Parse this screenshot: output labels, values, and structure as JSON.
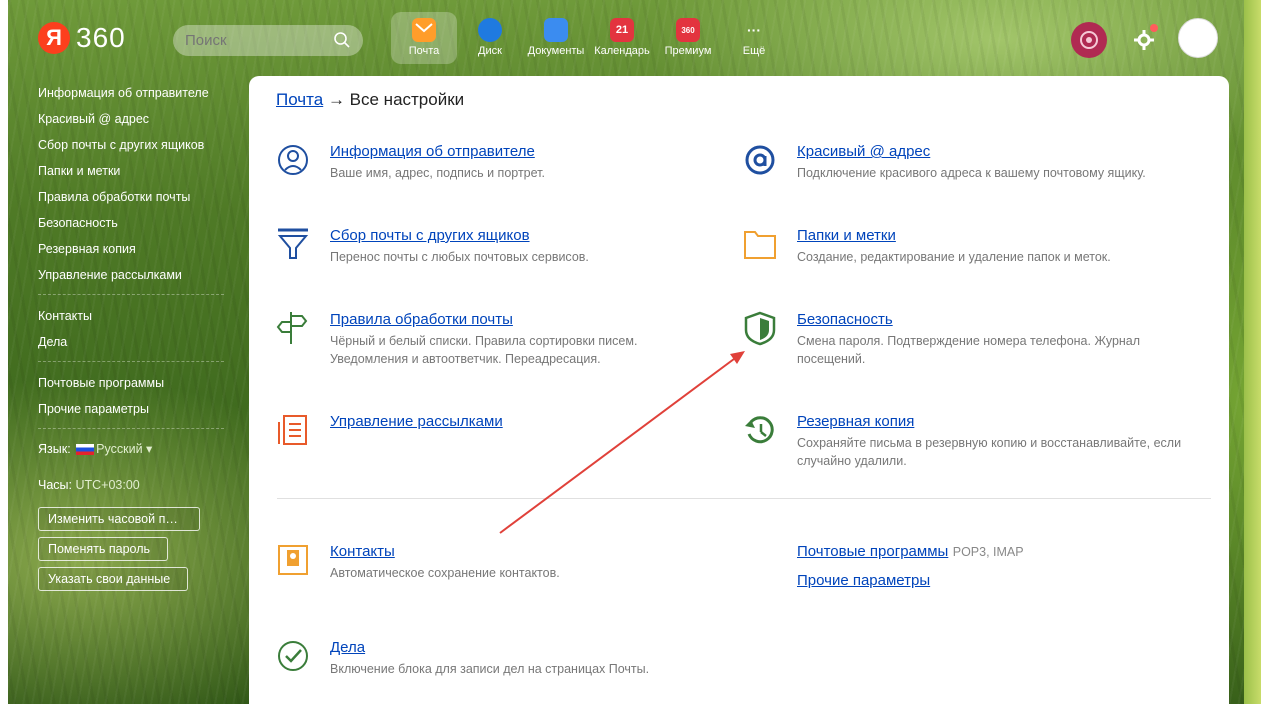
{
  "header": {
    "logo_letter": "Я",
    "logo_text": "360",
    "search_placeholder": "Поиск",
    "apps": [
      {
        "label": "Почта",
        "color": "#ff9d2a",
        "badge": ""
      },
      {
        "label": "Диск",
        "color": "#1f7ae0",
        "badge": ""
      },
      {
        "label": "Документы",
        "color": "#3b8cf0",
        "badge": ""
      },
      {
        "label": "Календарь",
        "color": "#e3343f",
        "badge": "21"
      },
      {
        "label": "Премиум",
        "color": "#e3343f",
        "badge": "360"
      },
      {
        "label": "Ещё",
        "color": "transparent",
        "badge": "···"
      }
    ]
  },
  "sidebar": {
    "items": [
      "Информация об отправителе",
      "Красивый @ адрес",
      "Сбор почты с других ящиков",
      "Папки и метки",
      "Правила обработки почты",
      "Безопасность",
      "Резервная копия",
      "Управление рассылками"
    ],
    "items2": [
      "Контакты",
      "Дела"
    ],
    "items3": [
      "Почтовые программы",
      "Прочие параметры"
    ],
    "lang_label": "Язык:",
    "lang_value": "Русский",
    "clock_label": "Часы:",
    "clock_value": "UTC+03:00",
    "buttons": [
      "Изменить часовой п…",
      "Поменять пароль",
      "Указать свои данные"
    ]
  },
  "main": {
    "breadcrumb_link": "Почта",
    "breadcrumb_rest": " → Все настройки",
    "cards": [
      {
        "title": "Информация об отправителе",
        "desc": "Ваше имя, адрес, подпись и портрет."
      },
      {
        "title": "Красивый @ адрес",
        "desc": "Подключение красивого адреса к вашему почтовому ящику."
      },
      {
        "title": "Сбор почты с других ящиков",
        "desc": "Перенос почты с любых почтовых сервисов."
      },
      {
        "title": "Папки и метки",
        "desc": "Создание, редактирование и удаление папок и меток."
      },
      {
        "title": "Правила обработки почты",
        "desc": "Чёрный и белый списки. Правила сортировки писем. Уведомления и автоответчик. Переадресация."
      },
      {
        "title": "Безопасность",
        "desc": "Смена пароля. Подтверждение номера телефона. Журнал посещений."
      },
      {
        "title": "Управление рассылками",
        "desc": ""
      },
      {
        "title": "Резервная копия",
        "desc": "Сохраняйте письма в резервную копию и восстанавливайте, если случайно удалили."
      },
      {
        "title": "Контакты",
        "desc": "Автоматическое сохранение контактов."
      },
      {
        "title": "Дела",
        "desc": "Включение блока для записи дел на страницах Почты."
      }
    ],
    "mail_programs": "Почтовые программы",
    "mail_programs_note": "POP3, IMAP",
    "other_params": "Прочие параметры"
  },
  "colors": {
    "link": "#0044bb",
    "icon_blue": "#1f4fa0",
    "icon_orange": "#f0a030",
    "icon_green": "#3a7d3a",
    "arrow": "#e0413a"
  }
}
